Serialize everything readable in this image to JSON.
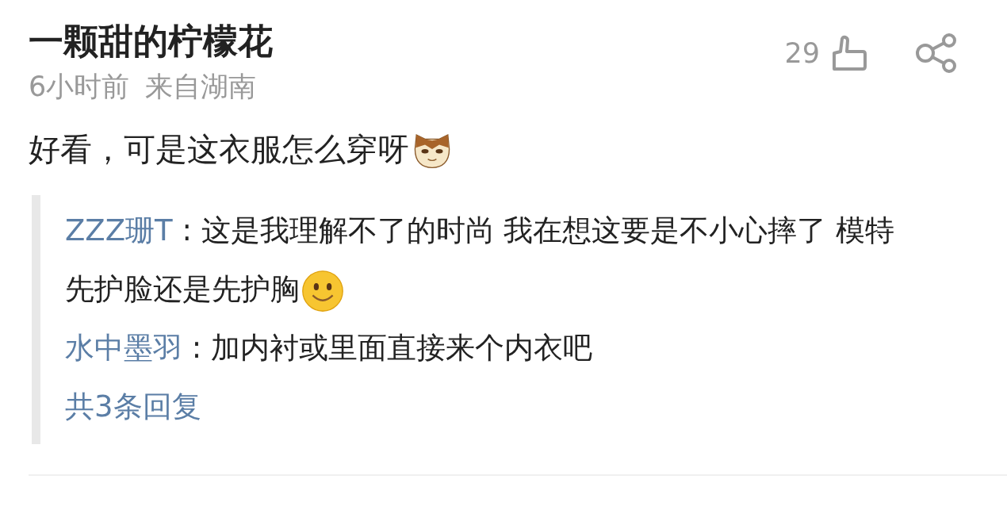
{
  "comment": {
    "author": "一颗甜的柠檬花",
    "time": "6小时前",
    "location": "来自湖南",
    "likes": "29",
    "text": "好看，可是这衣服怎么穿呀",
    "emoji": {
      "kind": "cat"
    },
    "replies": [
      {
        "author": "ZZZ珊T",
        "text": " : 这是我理解不了的时尚 我在想这要是不小心摔了 模特先护脸还是先护胸",
        "emoji": {
          "kind": "smile"
        }
      },
      {
        "author": "水中墨羽",
        "text": " : 加内衬或里面直接来个内衣吧"
      }
    ],
    "more_replies": "共3条回复"
  }
}
